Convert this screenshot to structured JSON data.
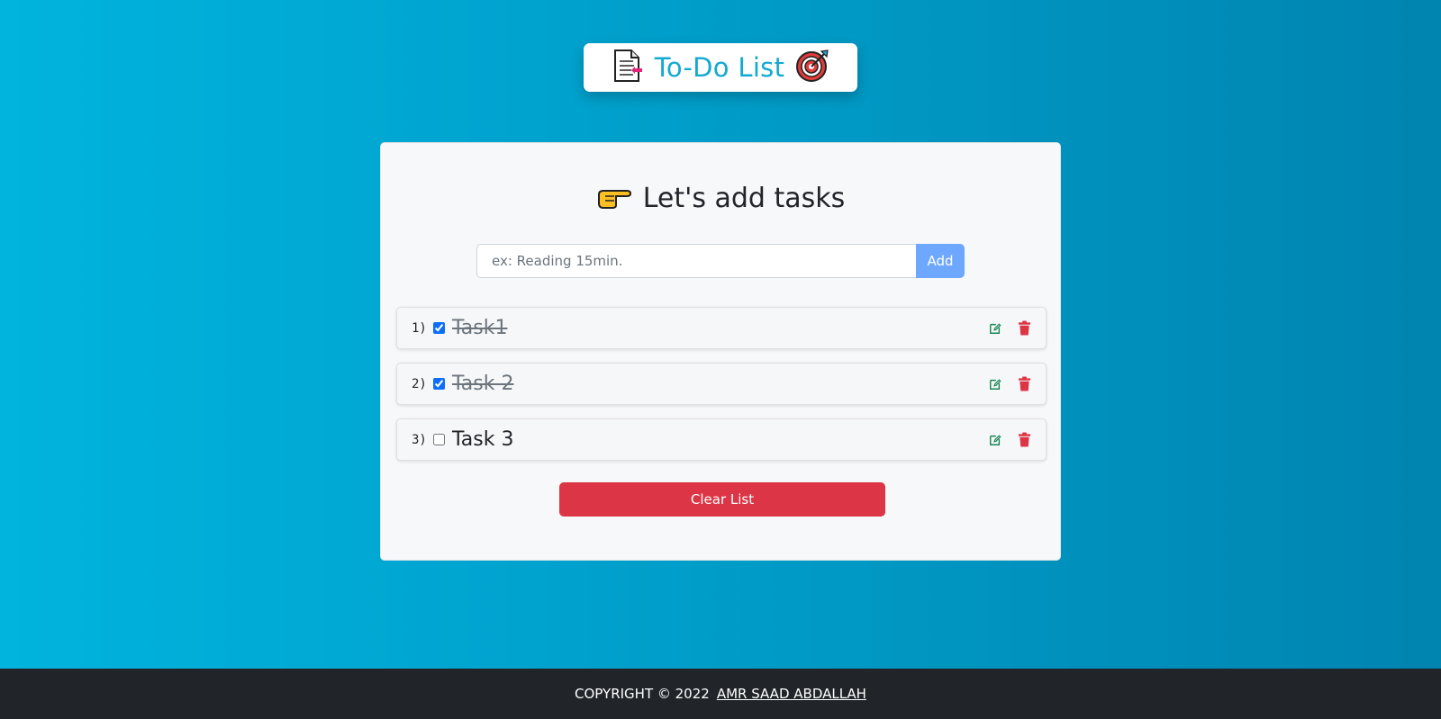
{
  "header": {
    "title": "To-Do List",
    "left_icon": "document-icon",
    "right_icon": "target-icon"
  },
  "main": {
    "heading": "Let's add tasks",
    "heading_icon": "pointing-hand-icon",
    "input": {
      "placeholder": "ex: Reading 15min.",
      "value": ""
    },
    "add_label": "Add",
    "tasks": [
      {
        "number": "1)",
        "label": "Task1",
        "done": true
      },
      {
        "number": "2)",
        "label": "Task 2",
        "done": true
      },
      {
        "number": "3)",
        "label": "Task 3",
        "done": false
      }
    ],
    "clear_label": "Clear List"
  },
  "footer": {
    "copyright": "COPYRIGHT © 2022",
    "author": "AMR SAAD ABDALLAH"
  },
  "colors": {
    "accent": "#14a9d2",
    "add_button": "#6ea8fe",
    "danger": "#dc3545",
    "edit": "#198754",
    "footer_bg": "#212529"
  }
}
